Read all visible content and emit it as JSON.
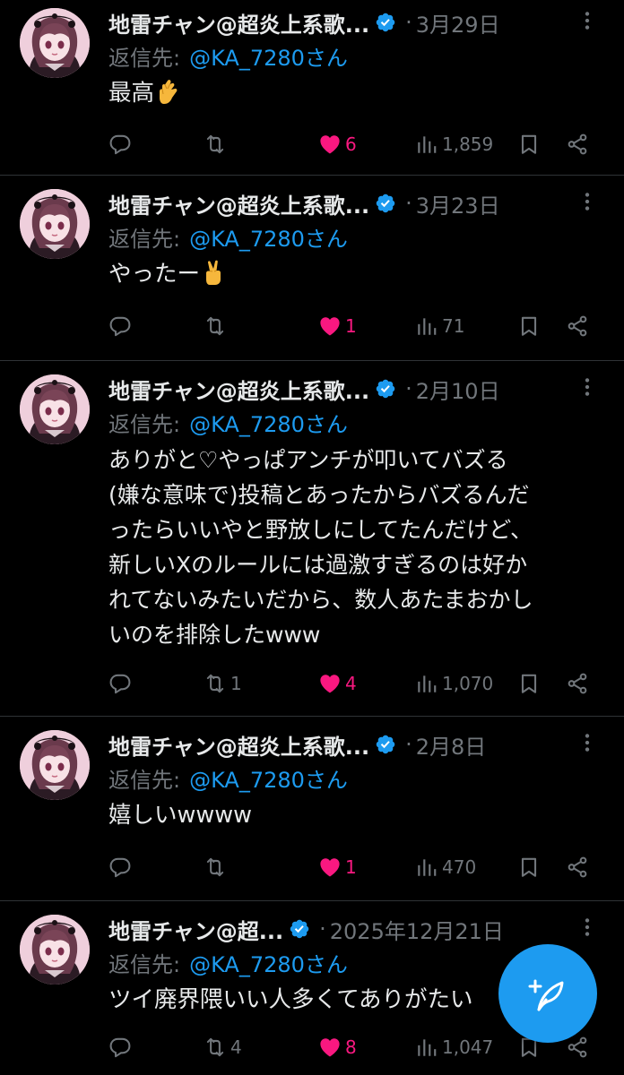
{
  "colors": {
    "background": "#000000",
    "text": "#e7e9ea",
    "muted": "#71767b",
    "accent_blue": "#1d9bf0",
    "like_pink": "#f91880",
    "divider": "#2f3336"
  },
  "icons": {
    "avatar": "avatar-image",
    "verified": "verified-badge-icon",
    "more": "more-options-icon",
    "reply": "reply-icon",
    "retweet": "retweet-icon",
    "like": "heart-icon-filled",
    "views": "views-chart-icon",
    "bookmark": "bookmark-icon",
    "share": "share-icon",
    "compose": "compose-post-icon"
  },
  "tweets": [
    {
      "name": "地雷チャン@超炎上系歌...",
      "dot": "·",
      "date": "3月29日",
      "reply_prefix": "返信先:",
      "reply_handle": "@KA_7280さん",
      "text": "最高",
      "emoji": "crossed-fingers",
      "replies": "",
      "retweets": "",
      "likes": "6",
      "views": "1,859"
    },
    {
      "name": "地雷チャン@超炎上系歌...",
      "dot": "·",
      "date": "3月23日",
      "reply_prefix": "返信先:",
      "reply_handle": "@KA_7280さん",
      "text": "やったー",
      "emoji": "victory-hand",
      "replies": "",
      "retweets": "",
      "likes": "1",
      "views": "71"
    },
    {
      "name": "地雷チャン@超炎上系歌...",
      "dot": "·",
      "date": "2月10日",
      "reply_prefix": "返信先:",
      "reply_handle": "@KA_7280さん",
      "text": "ありがと♡やっぱアンチが叩いてバズる\n(嫌な意味で)投稿とあったからバズるんだ\nったらいいやと野放しにしてたんだけど、\n新しいXのルールには過激すぎるのは好か\nれてないみたいだから、数人あたまおかし\nいのを排除したwww",
      "emoji": "",
      "replies": "",
      "retweets": "1",
      "likes": "4",
      "views": "1,070"
    },
    {
      "name": "地雷チャン@超炎上系歌...",
      "dot": "·",
      "date": "2月8日",
      "reply_prefix": "返信先:",
      "reply_handle": "@KA_7280さん",
      "text": "嬉しいwwww",
      "emoji": "",
      "replies": "",
      "retweets": "",
      "likes": "1",
      "views": "470"
    },
    {
      "name": "地雷チャン@超...",
      "dot": "·",
      "date": "2025年12月21日",
      "reply_prefix": "返信先:",
      "reply_handle": "@KA_7280さん",
      "text": "ツイ廃界隈いい人多くてありがたい",
      "emoji": "",
      "replies": "",
      "retweets": "4",
      "likes": "8",
      "views": "1,047"
    }
  ]
}
